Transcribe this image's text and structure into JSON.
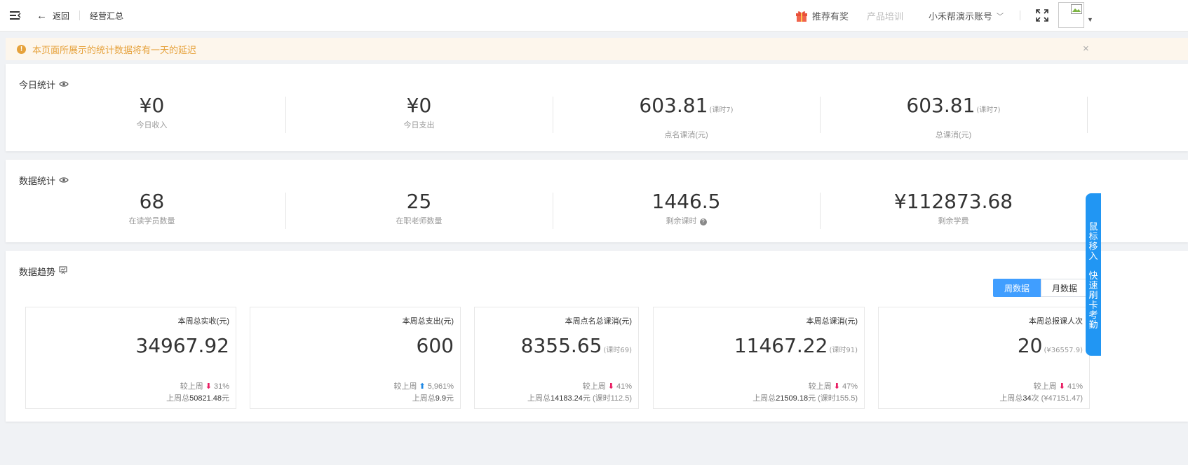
{
  "topbar": {
    "back_label": "返回",
    "breadcrumb": "经营汇总",
    "reward_label": "推荐有奖",
    "training_label": "产品培训",
    "account_label": "小禾帮演示账号"
  },
  "notice": {
    "text": "本页面所展示的统计数据将有一天的延迟",
    "close": "×"
  },
  "today": {
    "title": "今日统计",
    "items": [
      {
        "value": "¥0",
        "suffix": "",
        "label": "今日收入"
      },
      {
        "value": "¥0",
        "suffix": "",
        "label": "今日支出"
      },
      {
        "value": "603.81",
        "suffix": "(课时7)",
        "label": "点名课消(元)"
      },
      {
        "value": "603.81",
        "suffix": "(课时7)",
        "label": "总课消(元)"
      }
    ]
  },
  "stats": {
    "title": "数据统计",
    "items": [
      {
        "value": "68",
        "label": "在读学员数量"
      },
      {
        "value": "25",
        "label": "在职老师数量"
      },
      {
        "value": "1446.5",
        "label": "剩余课时"
      },
      {
        "value": "¥112873.68",
        "label": "剩余学费"
      }
    ]
  },
  "trend": {
    "title": "数据趋势",
    "toggle": {
      "week": "周数据",
      "month": "月数据",
      "selected": "周数据"
    },
    "boxes": [
      {
        "title": "本周总实收(元)",
        "value": "34967.92",
        "value_suffix": "",
        "cmp_label": "较上周",
        "direction": "down",
        "pct": "31%",
        "last_label": "上周总",
        "last_value": "50821.48",
        "last_unit": "元",
        "last_extra": ""
      },
      {
        "title": "本周总支出(元)",
        "value": "600",
        "value_suffix": "",
        "cmp_label": "较上周",
        "direction": "up",
        "pct": "5,961%",
        "last_label": "上周总",
        "last_value": "9.9",
        "last_unit": "元",
        "last_extra": ""
      },
      {
        "title": "本周点名总课消(元)",
        "value": "8355.65",
        "value_suffix": "(课时69)",
        "cmp_label": "较上周",
        "direction": "down",
        "pct": "41%",
        "last_label": "上周总",
        "last_value": "14183.24",
        "last_unit": "元",
        "last_extra": "(课时112.5)"
      },
      {
        "title": "本周总课消(元)",
        "value": "11467.22",
        "value_suffix": "(课时91)",
        "cmp_label": "较上周",
        "direction": "down",
        "pct": "47%",
        "last_label": "上周总",
        "last_value": "21509.18",
        "last_unit": "元",
        "last_extra": "(课时155.5)"
      },
      {
        "title": "本周总报课人次",
        "value": "20",
        "value_suffix": "(¥36557.9)",
        "cmp_label": "较上周",
        "direction": "down",
        "pct": "41%",
        "last_label": "上周总",
        "last_value": "34",
        "last_unit": "次",
        "last_extra": "(¥47151.47)"
      }
    ]
  },
  "sidetab": {
    "chars_a": [
      "鼠",
      "标",
      "移",
      "入"
    ],
    "chars_b": [
      "快",
      "速",
      "刷",
      "卡",
      "考",
      "勤"
    ]
  }
}
